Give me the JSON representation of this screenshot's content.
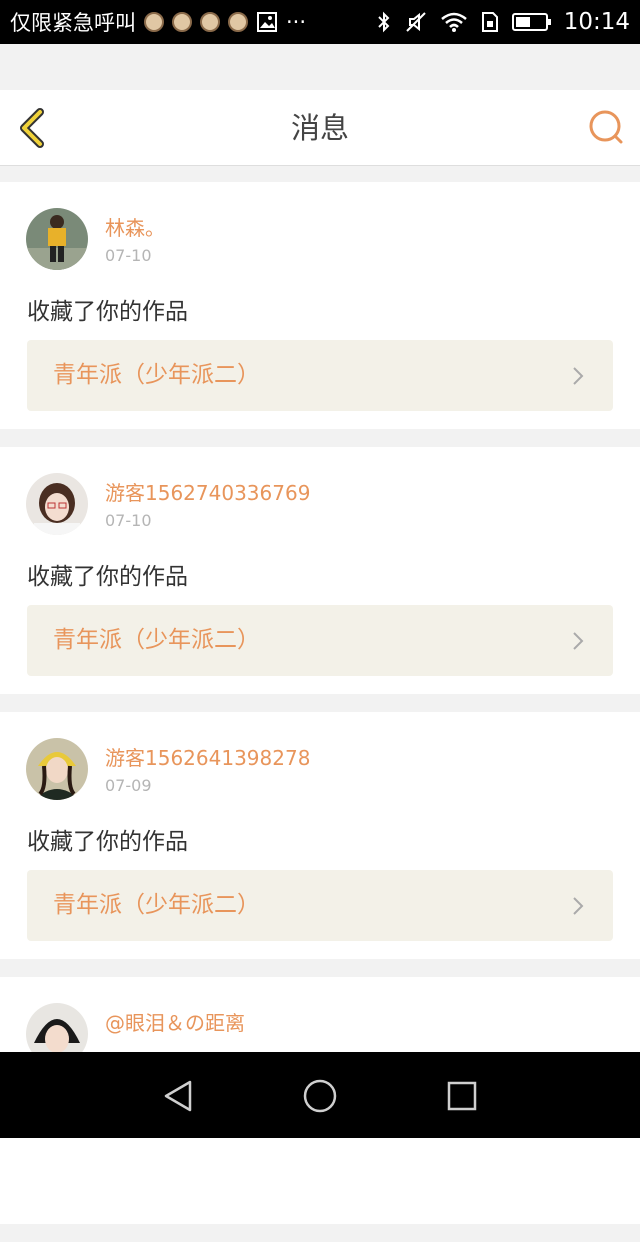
{
  "status_bar": {
    "carrier": "仅限紧急呼叫",
    "overflow": "···",
    "time": "10:14",
    "icons": [
      "avatar-icon",
      "avatar-icon",
      "avatar-icon",
      "avatar-icon",
      "image-icon",
      "bluetooth-icon",
      "mute-icon",
      "wifi-icon",
      "sim-icon",
      "battery-icon"
    ]
  },
  "header": {
    "title": "消息",
    "back_icon": "chevron-left-icon",
    "search_icon": "search-icon",
    "accent_color": "#e8955b",
    "back_color": "#f0d23a"
  },
  "messages": [
    {
      "name": "林森。",
      "date": "07-10",
      "action": "收藏了你的作品",
      "work": "青年派（少年派二）"
    },
    {
      "name": "游客1562740336769",
      "date": "07-10",
      "action": "收藏了你的作品",
      "work": "青年派（少年派二）"
    },
    {
      "name": "游客1562641398278",
      "date": "07-09",
      "action": "收藏了你的作品",
      "work": "青年派（少年派二）"
    },
    {
      "name": "@眼泪＆の距离",
      "date": "",
      "action": "",
      "work": ""
    }
  ],
  "nav_bar": {
    "icons": [
      "back-triangle-icon",
      "home-circle-icon",
      "recents-square-icon"
    ]
  }
}
